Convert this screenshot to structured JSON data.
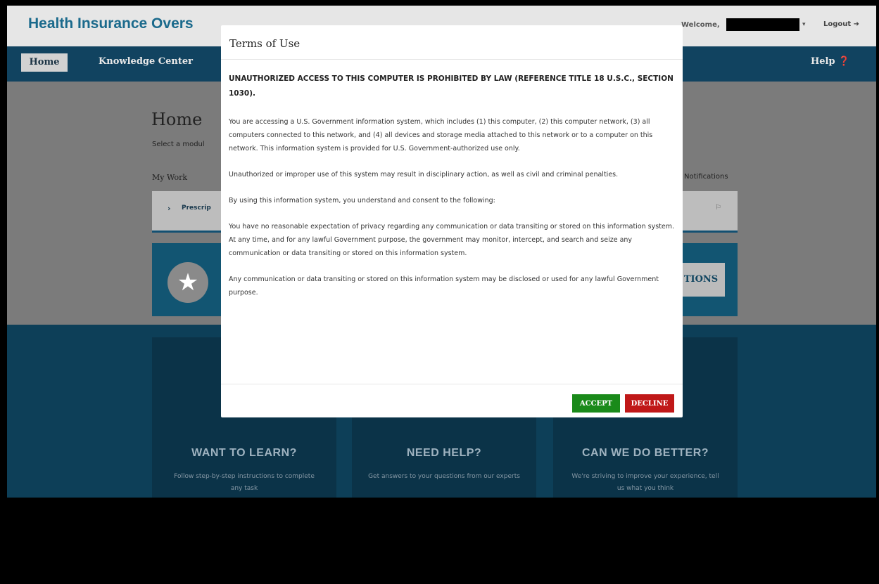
{
  "header": {
    "brand": "Health Insurance Overs",
    "welcome_label": "Welcome,",
    "logout_label": "Logout ➜"
  },
  "nav": {
    "home": "Home",
    "knowledge_center": "Knowledge Center",
    "help": "Help ❓"
  },
  "main": {
    "title": "Home",
    "subtitle": "Select a modul",
    "my_work": "My Work",
    "notifications": "Notifications",
    "work_item": "Prescrip",
    "favorites_button": "TIONS"
  },
  "cards": [
    {
      "title": "WANT TO LEARN?",
      "text": "Follow step-by-step instructions to complete any task"
    },
    {
      "title": "NEED HELP?",
      "text": "Get answers to your questions from our experts"
    },
    {
      "title": "CAN WE DO BETTER?",
      "text": "We're striving to improve your experience, tell us what you think"
    }
  ],
  "modal": {
    "title": "Terms of Use",
    "warning": "UNAUTHORIZED ACCESS TO THIS COMPUTER IS PROHIBITED BY LAW (REFERENCE TITLE 18 U.S.C., SECTION 1030).",
    "paragraphs": [
      "You are accessing a U.S. Government information system, which includes (1) this computer, (2) this computer network, (3) all computers connected to this network, and (4) all devices and storage media attached to this network or to a computer on this network. This information system is provided for U.S. Government-authorized use only.",
      "Unauthorized or improper use of this system may result in disciplinary action, as well as civil and criminal penalties.",
      "By using this information system, you understand and consent to the following:",
      "You have no reasonable expectation of privacy regarding any communication or data transiting or stored on this information system. At any time, and for any lawful Government purpose, the government may monitor, intercept, and search and seize any communication or data transiting or stored on this information system.",
      "Any communication or data transiting or stored on this information system may be disclosed or used for any lawful Government purpose."
    ],
    "accept_label": "ACCEPT",
    "decline_label": "DECLINE"
  },
  "colors": {
    "brand": "#1b6a8c",
    "nav": "#114360",
    "accept": "#1a8a1a",
    "decline": "#c01818"
  }
}
